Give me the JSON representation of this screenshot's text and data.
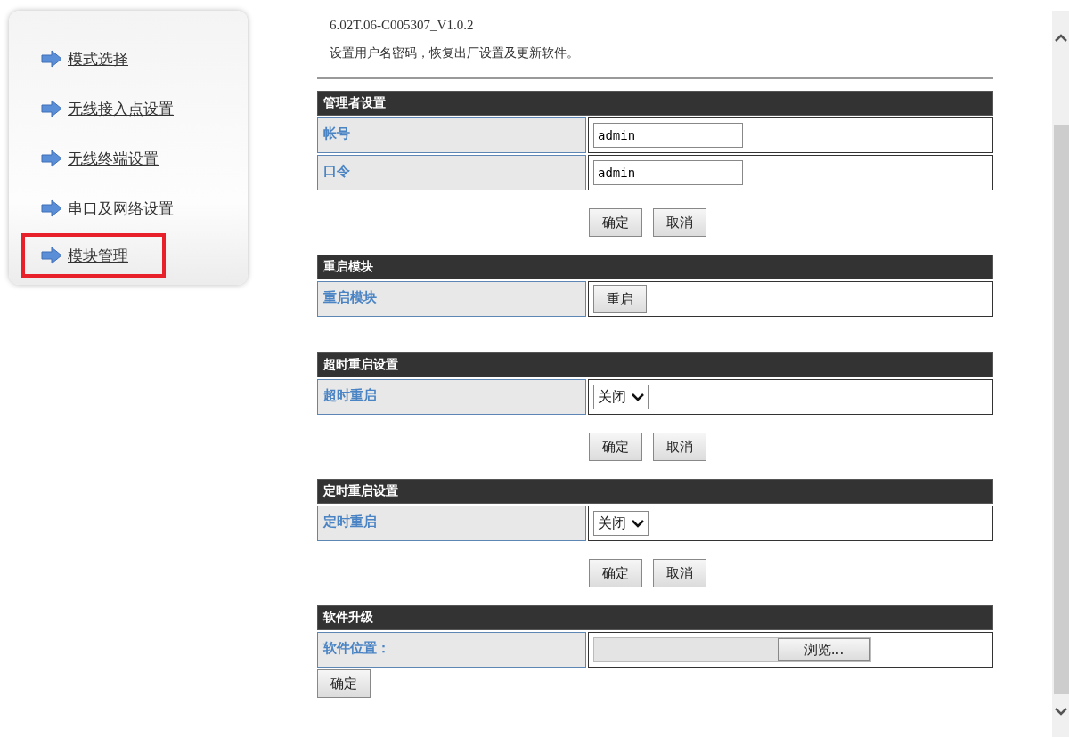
{
  "sidebar": {
    "items": [
      {
        "label": "模式选择",
        "highlighted": false
      },
      {
        "label": "无线接入点设置",
        "highlighted": false
      },
      {
        "label": "无线终端设置",
        "highlighted": false
      },
      {
        "label": "串口及网络设置",
        "highlighted": false
      },
      {
        "label": "模块管理",
        "highlighted": true
      }
    ]
  },
  "version": "6.02T.06-C005307_V1.0.2",
  "description": "设置用户名密码，恢复出厂设置及更新软件。",
  "sections": [
    {
      "title": "管理者设置",
      "rows": [
        {
          "label": "帐号",
          "kind": "input",
          "value": "admin"
        },
        {
          "label": "口令",
          "kind": "input",
          "value": "admin"
        }
      ],
      "actions": [
        "确定",
        "取消"
      ]
    },
    {
      "title": "重启模块",
      "rows": [
        {
          "label": "重启模块",
          "kind": "button",
          "value": "重启"
        }
      ]
    },
    {
      "title": "超时重启设置",
      "rows": [
        {
          "label": "超时重启",
          "kind": "select",
          "value": "关闭"
        }
      ],
      "actions": [
        "确定",
        "取消"
      ]
    },
    {
      "title": "定时重启设置",
      "rows": [
        {
          "label": "定时重启",
          "kind": "select",
          "value": "关闭"
        }
      ],
      "actions": [
        "确定",
        "取消"
      ]
    },
    {
      "title": "软件升级",
      "rows": [
        {
          "label": "软件位置：",
          "kind": "file",
          "value": "浏览..."
        }
      ],
      "actions": [
        "确定"
      ]
    }
  ]
}
